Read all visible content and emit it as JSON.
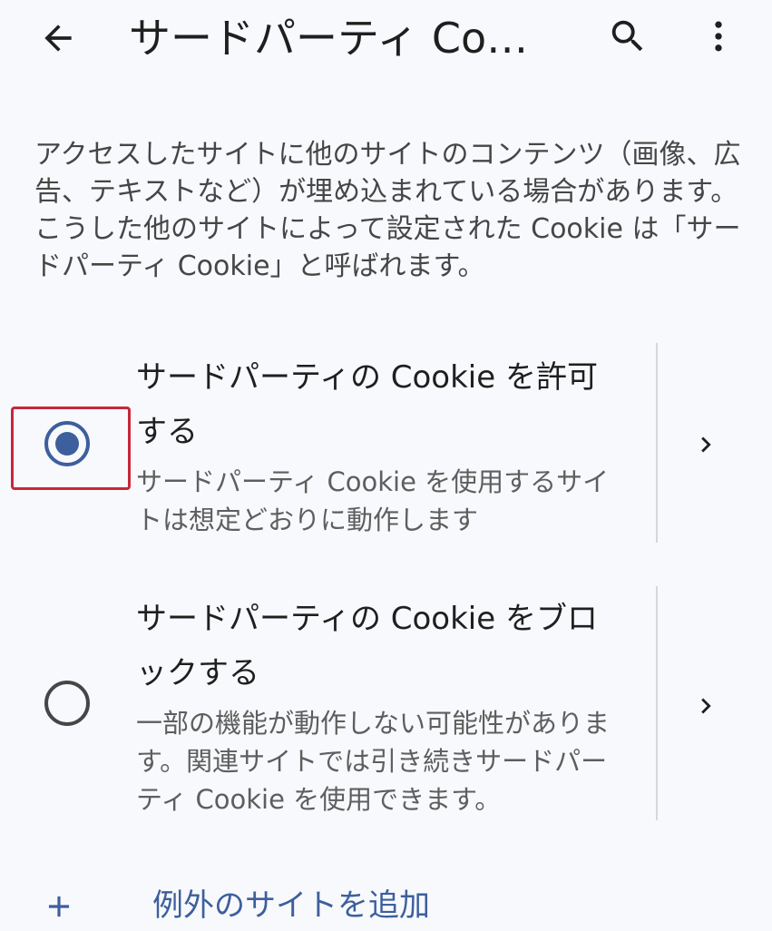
{
  "appbar": {
    "title": "サードパーティ Co…",
    "back_icon": "arrow-back-icon",
    "search_icon": "search-icon",
    "more_icon": "more-vert-icon"
  },
  "description": "アクセスしたサイトに他のサイトのコンテンツ（画像、広告、テキストなど）が埋め込まれている場合があります。こうした他のサイトによって設定された Cookie は「サードパーティ Cookie」と呼ばれます。",
  "options": [
    {
      "title": "サードパーティの Cookie を許可する",
      "subtitle": "サードパーティ Cookie を使用するサイトは想定どおりに動作します",
      "selected": true
    },
    {
      "title": "サードパーティの Cookie をブロックする",
      "subtitle": "一部の機能が動作しない可能性があります。関連サイトでは引き続きサードパーティ Cookie を使用できます。",
      "selected": false
    }
  ],
  "add_exception": {
    "label": "例外のサイトを追加",
    "icon": "plus-icon"
  },
  "colors": {
    "accent": "#3d5f9d",
    "highlight": "#c6273a",
    "background": "#f8f9fc"
  }
}
